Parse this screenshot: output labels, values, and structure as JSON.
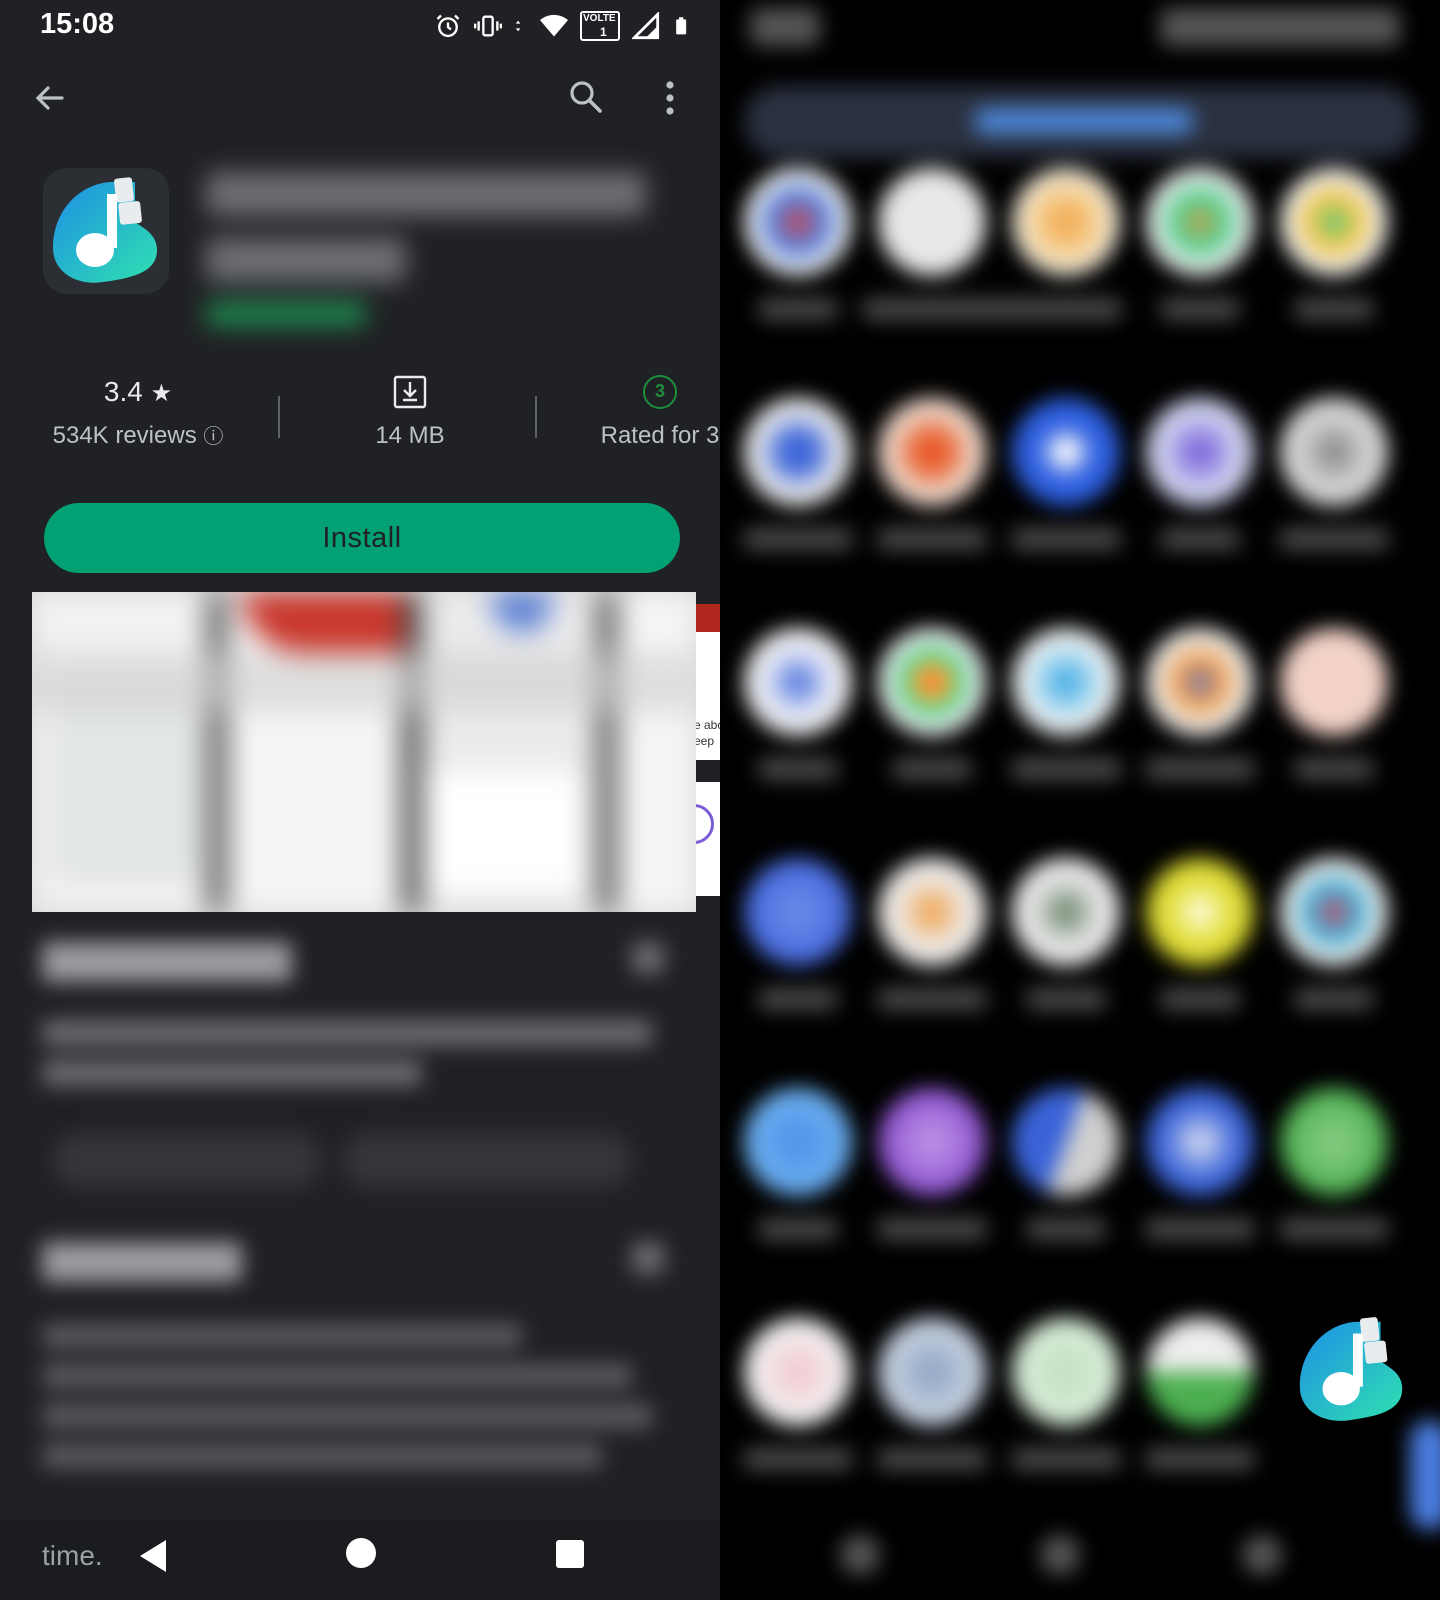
{
  "status_bar": {
    "time": "15:08",
    "icons": [
      "alarm-icon",
      "vibrate-icon",
      "data-arrows-icon",
      "wifi-icon",
      "volte-icon",
      "signal-icon",
      "battery-icon"
    ],
    "volte_label_top": "VOLTE",
    "volte_label_bottom": "1"
  },
  "toolbar": {
    "back": "back-arrow-icon",
    "search": "search-icon",
    "more": "more-vert-icon"
  },
  "app": {
    "icon": "music-note-app-icon",
    "brand_colors": {
      "gradient_start": "#1ea3e6",
      "gradient_end": "#2fd9b0"
    }
  },
  "stats": {
    "rating_value": "3.4",
    "rating_star": "★",
    "reviews_text": "534K reviews",
    "reviews_info": "ⓘ",
    "size_text": "14 MB",
    "content_rating_badge": "3",
    "content_rating_text": "Rated for 3"
  },
  "install": {
    "label": "Install",
    "color": "#01a173"
  },
  "peek": {
    "line1": "e abo",
    "line2": "eep"
  },
  "bottom_peek_text": "time.",
  "navbar": {
    "back": "nav-back-icon",
    "home": "nav-home-icon",
    "recents": "nav-recents-icon"
  },
  "launcher": {
    "dragged_icon": "music-note-app-icon"
  }
}
